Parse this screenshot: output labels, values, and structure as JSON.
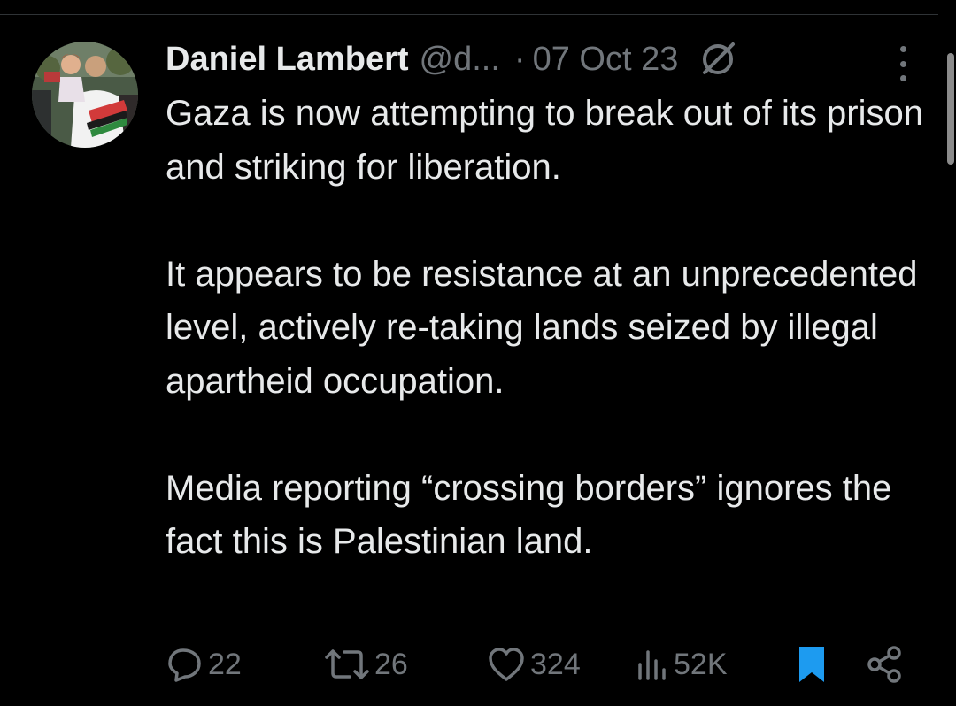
{
  "tweet": {
    "author": {
      "display_name": "Daniel Lambert",
      "handle": "@d...",
      "avatar_icon": "avatar-photo"
    },
    "separator": "·",
    "date": "07 Oct 23",
    "verified_icon": "verified-slash-icon",
    "more_icon": "more-vertical-icon",
    "paragraphs": [
      "Gaza is now attempting to break out of its prison and striking for liberation.",
      "It appears to be resistance at an unprecedented level, actively re-taking lands seized by illegal apartheid occupation.",
      "Media reporting “crossing borders” ignores the fact this is Palestinian land."
    ],
    "actions": {
      "replies": "22",
      "reposts": "26",
      "likes": "324",
      "views": "52K",
      "bookmark_icon": "bookmark-icon",
      "share_icon": "share-icon"
    }
  },
  "colors": {
    "background": "#000000",
    "text": "#e7e9ea",
    "muted": "#71767b",
    "bookmark": "#1d9bf0"
  }
}
